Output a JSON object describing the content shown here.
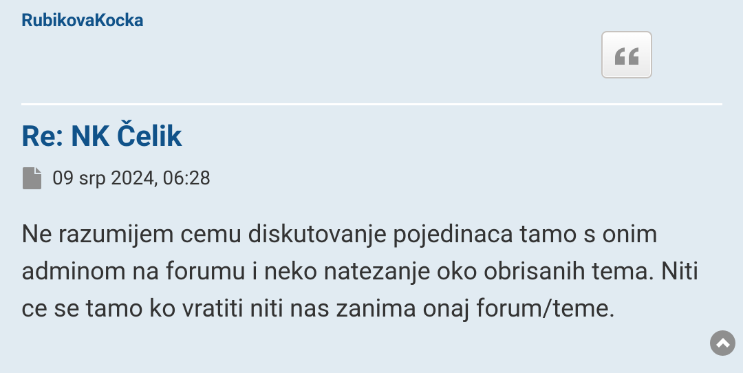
{
  "post": {
    "author": "RubikovaKocka",
    "title": "Re: NK Čelik",
    "date": "09 srp 2024, 06:28",
    "content": "Ne razumijem cemu diskutovanje pojedinaca tamo s onim adminom na forumu i neko natezanje oko obrisanih tema. Niti ce se tamo ko vratiti niti nas zanima onaj forum/teme."
  },
  "icons": {
    "quote": "quote-icon",
    "post": "file-icon",
    "top": "chevron-up-circle-icon"
  },
  "colors": {
    "background": "#e1ebf2",
    "link": "#105289",
    "text": "#333333",
    "icon_gray": "#8f8f8f"
  }
}
